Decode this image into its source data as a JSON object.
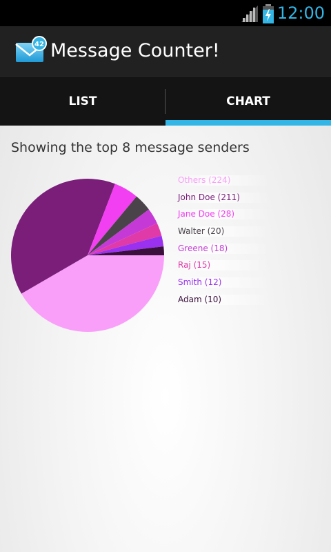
{
  "status_bar": {
    "time": "12:00",
    "signal_icon": "signal-icon",
    "battery_icon": "battery-charging-icon",
    "clock_color": "#33b5e5"
  },
  "action_bar": {
    "title": "Message Counter!",
    "app_icon": "envelope-badge-icon",
    "badge_count": "42"
  },
  "tabs": [
    {
      "label": "LIST",
      "selected": false
    },
    {
      "label": "CHART",
      "selected": true
    }
  ],
  "accent_color": "#33b5e5",
  "subtitle": "Showing the top 8 message senders",
  "chart_data": {
    "type": "pie",
    "title": "",
    "slices": [
      {
        "name": "Others",
        "value": 224,
        "color": "#f99ff9",
        "legend": "Others (224)"
      },
      {
        "name": "John Doe",
        "value": 211,
        "color": "#7a1e7a",
        "legend": "John Doe (211)"
      },
      {
        "name": "Jane Doe",
        "value": 28,
        "color": "#f23ff2",
        "legend": "Jane Doe (28)"
      },
      {
        "name": "Walter",
        "value": 20,
        "color": "#4a434a",
        "legend": "Walter (20)"
      },
      {
        "name": "Greene",
        "value": 18,
        "color": "#c53ad6",
        "legend": "Greene (18)"
      },
      {
        "name": "Raj",
        "value": 15,
        "color": "#e03aa8",
        "legend": "Raj (15)"
      },
      {
        "name": "Smith",
        "value": 12,
        "color": "#9a30f0",
        "legend": "Smith (12)"
      },
      {
        "name": "Adam",
        "value": 10,
        "color": "#3b0f3b",
        "legend": "Adam (10)"
      }
    ],
    "legend_placement": "right"
  }
}
